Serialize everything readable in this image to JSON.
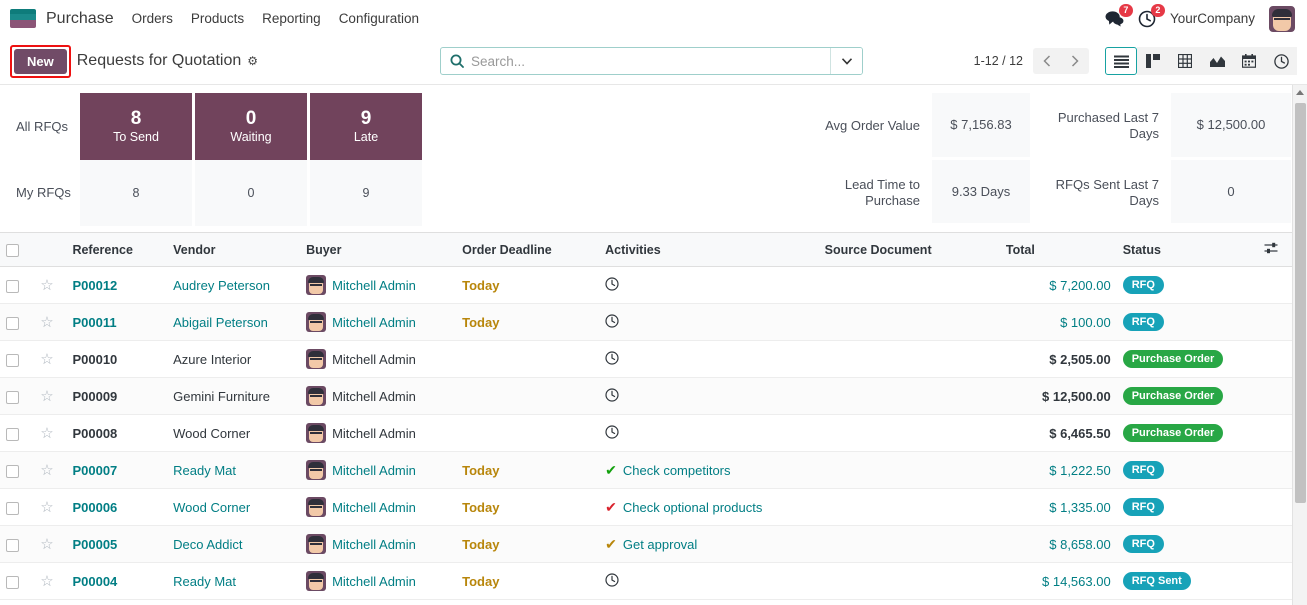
{
  "navbar": {
    "brand": "Purchase",
    "logo_icon": "purchase-app-logo",
    "menu": [
      {
        "label": "Orders"
      },
      {
        "label": "Products"
      },
      {
        "label": "Reporting"
      },
      {
        "label": "Configuration"
      }
    ],
    "messages_icon": "messages-icon",
    "messages_count": "7",
    "activities_icon": "activity-clock-icon",
    "activities_count": "2",
    "company": "YourCompany",
    "avatar_icon": "user-avatar"
  },
  "control_panel": {
    "new_label": "New",
    "breadcrumb": "Requests for Quotation",
    "gear_icon": "gear-icon",
    "search": {
      "icon": "search-icon",
      "value": "",
      "placeholder": "Search...",
      "toggle_icon": "chevron-down-icon"
    },
    "pager": {
      "text": "1-12 / 12",
      "prev_icon": "chevron-left-icon",
      "next_icon": "chevron-right-icon"
    },
    "views": [
      {
        "name": "list-view",
        "icon": "list-icon",
        "active": true
      },
      {
        "name": "kanban-view",
        "icon": "kanban-icon",
        "active": false
      },
      {
        "name": "pivot-view",
        "icon": "pivot-icon",
        "active": false
      },
      {
        "name": "graph-view",
        "icon": "graph-icon",
        "active": false
      },
      {
        "name": "calendar-view",
        "icon": "calendar-icon",
        "active": false
      },
      {
        "name": "activity-view",
        "icon": "clock-icon",
        "active": false
      }
    ]
  },
  "kpi": {
    "row_labels": {
      "all": "All RFQs",
      "my": "My RFQs"
    },
    "columns": [
      {
        "label": "To Send",
        "all_value": "8",
        "my_value": "8"
      },
      {
        "label": "Waiting",
        "all_value": "0",
        "my_value": "0"
      },
      {
        "label": "Late",
        "all_value": "9",
        "my_value": "9"
      }
    ],
    "metrics": [
      {
        "label": "Avg Order Value",
        "value": "$ 7,156.83"
      },
      {
        "label": "Lead Time to Purchase",
        "value": "9.33 Days"
      },
      {
        "label": "Purchased Last 7 Days",
        "value": "$ 12,500.00"
      },
      {
        "label": "RFQs Sent Last 7 Days",
        "value": "0"
      }
    ],
    "accent_color": "#71435c"
  },
  "table": {
    "headers": {
      "reference": "Reference",
      "vendor": "Vendor",
      "buyer": "Buyer",
      "order_deadline": "Order Deadline",
      "activities": "Activities",
      "source_document": "Source Document",
      "total": "Total",
      "status": "Status",
      "optional_columns_icon": "sliders-icon"
    },
    "rows": [
      {
        "reference": "P00012",
        "ref_link": true,
        "vendor": "Audrey Peterson",
        "vendor_link": true,
        "buyer": "Mitchell Admin",
        "buyer_link": true,
        "order_deadline": "Today",
        "activity_label": "",
        "activity_icon": "clock-icon",
        "activity_color": "",
        "source_document": "",
        "total": "$ 7,200.00",
        "total_link": true,
        "status": "RFQ",
        "status_type": "rfq"
      },
      {
        "reference": "P00011",
        "ref_link": true,
        "vendor": "Abigail Peterson",
        "vendor_link": true,
        "buyer": "Mitchell Admin",
        "buyer_link": true,
        "order_deadline": "Today",
        "activity_label": "",
        "activity_icon": "clock-icon",
        "activity_color": "",
        "source_document": "",
        "total": "$ 100.00",
        "total_link": true,
        "status": "RFQ",
        "status_type": "rfq"
      },
      {
        "reference": "P00010",
        "ref_link": false,
        "vendor": "Azure Interior",
        "vendor_link": false,
        "buyer": "Mitchell Admin",
        "buyer_link": false,
        "order_deadline": "",
        "activity_label": "",
        "activity_icon": "clock-icon",
        "activity_color": "",
        "source_document": "",
        "total": "$ 2,505.00",
        "total_link": false,
        "status": "Purchase Order",
        "status_type": "po"
      },
      {
        "reference": "P00009",
        "ref_link": false,
        "vendor": "Gemini Furniture",
        "vendor_link": false,
        "buyer": "Mitchell Admin",
        "buyer_link": false,
        "order_deadline": "",
        "activity_label": "",
        "activity_icon": "clock-icon",
        "activity_color": "",
        "source_document": "",
        "total": "$ 12,500.00",
        "total_link": false,
        "status": "Purchase Order",
        "status_type": "po"
      },
      {
        "reference": "P00008",
        "ref_link": false,
        "vendor": "Wood Corner",
        "vendor_link": false,
        "buyer": "Mitchell Admin",
        "buyer_link": false,
        "order_deadline": "",
        "activity_label": "",
        "activity_icon": "clock-icon",
        "activity_color": "",
        "source_document": "",
        "total": "$ 6,465.50",
        "total_link": false,
        "status": "Purchase Order",
        "status_type": "po"
      },
      {
        "reference": "P00007",
        "ref_link": true,
        "vendor": "Ready Mat",
        "vendor_link": true,
        "buyer": "Mitchell Admin",
        "buyer_link": true,
        "order_deadline": "Today",
        "activity_label": "Check competitors",
        "activity_icon": "check-icon",
        "activity_color": "#13a10e",
        "source_document": "",
        "total": "$ 1,222.50",
        "total_link": true,
        "status": "RFQ",
        "status_type": "rfq"
      },
      {
        "reference": "P00006",
        "ref_link": true,
        "vendor": "Wood Corner",
        "vendor_link": true,
        "buyer": "Mitchell Admin",
        "buyer_link": true,
        "order_deadline": "Today",
        "activity_label": "Check optional products",
        "activity_icon": "check-icon",
        "activity_color": "#d9232d",
        "source_document": "",
        "total": "$ 1,335.00",
        "total_link": true,
        "status": "RFQ",
        "status_type": "rfq"
      },
      {
        "reference": "P00005",
        "ref_link": true,
        "vendor": "Deco Addict",
        "vendor_link": true,
        "buyer": "Mitchell Admin",
        "buyer_link": true,
        "order_deadline": "Today",
        "activity_label": "Get approval",
        "activity_icon": "check-icon",
        "activity_color": "#b8860b",
        "source_document": "",
        "total": "$ 8,658.00",
        "total_link": true,
        "status": "RFQ",
        "status_type": "rfq"
      },
      {
        "reference": "P00004",
        "ref_link": true,
        "vendor": "Ready Mat",
        "vendor_link": true,
        "buyer": "Mitchell Admin",
        "buyer_link": true,
        "order_deadline": "Today",
        "activity_label": "",
        "activity_icon": "clock-icon",
        "activity_color": "",
        "source_document": "",
        "total": "$ 14,563.00",
        "total_link": true,
        "status": "RFQ Sent",
        "status_type": "sent"
      }
    ]
  }
}
